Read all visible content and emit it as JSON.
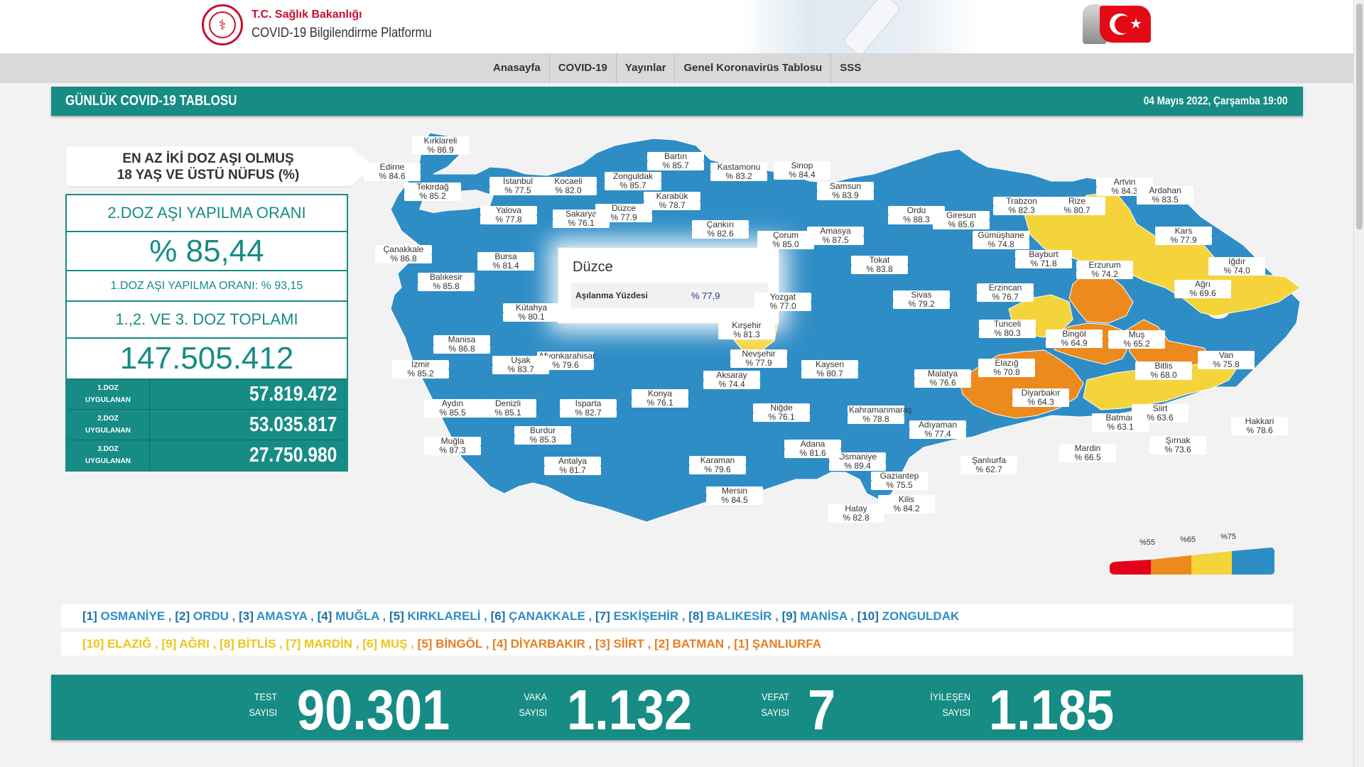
{
  "header": {
    "ministry": "T.C. Sağlık Bakanlığı",
    "platform": "COVID-19 Bilgilendirme Platformu"
  },
  "nav": [
    "Anasayfa",
    "COVID-19",
    "Yayınlar",
    "Genel Koronavirüs Tablosu",
    "SSS"
  ],
  "banner": {
    "title": "GÜNLÜK COVID-19 TABLOSU",
    "date": "04 Mayıs 2022, Çarşamba 19:00"
  },
  "vaccine": {
    "title_line1": "EN AZ İKİ DOZ AŞI OLMUŞ",
    "title_line2": "18 YAŞ VE ÜSTÜ NÜFUS (%)",
    "dose2_label": "2.DOZ AŞI YAPILMA ORANI",
    "dose2_value": "% 85,44",
    "dose1_rate": "1.DOZ AŞI YAPILMA ORANI: % 93,15",
    "total_label": "1.,2. VE 3. DOZ TOPLAMI",
    "total_value": "147.505.412",
    "doses": [
      {
        "label1": "1.DOZ",
        "label2": "UYGULANAN",
        "value": "57.819.472"
      },
      {
        "label1": "2.DOZ",
        "label2": "UYGULANAN",
        "value": "53.035.817"
      },
      {
        "label1": "3.DOZ",
        "label2": "UYGULANAN",
        "value": "27.750.980"
      }
    ]
  },
  "tooltip": {
    "title": "Düzce",
    "label": "Aşılanma Yüzdesi",
    "value": "% 77,9"
  },
  "provinces": [
    {
      "name": "Kırklareli",
      "value": "% 86.9"
    },
    {
      "name": "Edirne",
      "value": "% 84.6"
    },
    {
      "name": "Tekirdağ",
      "value": "% 85.2"
    },
    {
      "name": "İstanbul",
      "value": "% 77.5"
    },
    {
      "name": "Kocaeli",
      "value": "% 82.0"
    },
    {
      "name": "Yalova",
      "value": "% 77.8"
    },
    {
      "name": "Sakarya",
      "value": "% 76.1"
    },
    {
      "name": "Zonguldak",
      "value": "% 85.7"
    },
    {
      "name": "Bartın",
      "value": "% 85.7"
    },
    {
      "name": "Karabük",
      "value": "% 78.7"
    },
    {
      "name": "Düzce",
      "value": "% 77.9"
    },
    {
      "name": "Kastamonu",
      "value": "% 83.2"
    },
    {
      "name": "Sinop",
      "value": "% 84.4"
    },
    {
      "name": "Samsun",
      "value": "% 83.9"
    },
    {
      "name": "Çankırı",
      "value": "% 82.6"
    },
    {
      "name": "Çorum",
      "value": "% 85.0"
    },
    {
      "name": "Amasya",
      "value": "% 87.5"
    },
    {
      "name": "Ordu",
      "value": "% 88.3"
    },
    {
      "name": "Giresun",
      "value": "% 85.6"
    },
    {
      "name": "Trabzon",
      "value": "% 82.3"
    },
    {
      "name": "Rize",
      "value": "% 80.7"
    },
    {
      "name": "Artvin",
      "value": "% 84.3"
    },
    {
      "name": "Ardahan",
      "value": "% 83.5"
    },
    {
      "name": "Kars",
      "value": "% 77.9"
    },
    {
      "name": "Gümüşhane",
      "value": "% 74.8"
    },
    {
      "name": "Bayburt",
      "value": "% 71.8"
    },
    {
      "name": "Erzurum",
      "value": "% 74.2"
    },
    {
      "name": "Iğdır",
      "value": "% 74.0"
    },
    {
      "name": "Ağrı",
      "value": "% 69.6"
    },
    {
      "name": "Tokat",
      "value": "% 83.8"
    },
    {
      "name": "Sivas",
      "value": "% 79.2"
    },
    {
      "name": "Erzincan",
      "value": "% 76.7"
    },
    {
      "name": "Tunceli",
      "value": "% 80.3"
    },
    {
      "name": "Bingöl",
      "value": "% 64.9"
    },
    {
      "name": "Muş",
      "value": "% 65.2"
    },
    {
      "name": "Van",
      "value": "% 75.8"
    },
    {
      "name": "Bitlis",
      "value": "% 68.0"
    },
    {
      "name": "Elazığ",
      "value": "% 70.8"
    },
    {
      "name": "Malatya",
      "value": "% 76.6"
    },
    {
      "name": "Diyarbakır",
      "value": "% 64.3"
    },
    {
      "name": "Batman",
      "value": "% 63.1"
    },
    {
      "name": "Siirt",
      "value": "% 63.6"
    },
    {
      "name": "Hakkari",
      "value": "% 78.6"
    },
    {
      "name": "Şırnak",
      "value": "% 73.6"
    },
    {
      "name": "Mardin",
      "value": "% 66.5"
    },
    {
      "name": "Şanlıurfa",
      "value": "% 62.7"
    },
    {
      "name": "Adıyaman",
      "value": "% 77.4"
    },
    {
      "name": "Kahramanmaraş",
      "value": "% 78.8"
    },
    {
      "name": "Gaziantep",
      "value": "% 75.5"
    },
    {
      "name": "Kilis",
      "value": "% 84.2"
    },
    {
      "name": "Osmaniye",
      "value": "% 89.4"
    },
    {
      "name": "Hatay",
      "value": "% 82.8"
    },
    {
      "name": "Adana",
      "value": "% 81.6"
    },
    {
      "name": "Mersin",
      "value": "% 84.5"
    },
    {
      "name": "Karaman",
      "value": "% 79.6"
    },
    {
      "name": "Niğde",
      "value": "% 76.1"
    },
    {
      "name": "Kayseri",
      "value": "% 80.7"
    },
    {
      "name": "Nevşehir",
      "value": "% 77.9"
    },
    {
      "name": "Aksaray",
      "value": "% 74.4"
    },
    {
      "name": "Kırşehir",
      "value": "% 81.3"
    },
    {
      "name": "Yozgat",
      "value": "% 77.0"
    },
    {
      "name": "Konya",
      "value": "% 76.1"
    },
    {
      "name": "Antalya",
      "value": "% 81.7"
    },
    {
      "name": "Burdur",
      "value": "% 85.3"
    },
    {
      "name": "Isparta",
      "value": "% 82.7"
    },
    {
      "name": "Afyonkarahisar",
      "value": "% 79.6"
    },
    {
      "name": "Kütahya",
      "value": "% 80.1"
    },
    {
      "name": "Uşak",
      "value": "% 83.7"
    },
    {
      "name": "Denizli",
      "value": "% 85.1"
    },
    {
      "name": "Aydın",
      "value": "% 85.5"
    },
    {
      "name": "Muğla",
      "value": "% 87.3"
    },
    {
      "name": "İzmir",
      "value": "% 85.2"
    },
    {
      "name": "Manisa",
      "value": "% 86.8"
    },
    {
      "name": "Balıkesir",
      "value": "% 85.8"
    },
    {
      "name": "Bursa",
      "value": "% 81.4"
    },
    {
      "name": "Çanakkale",
      "value": "% 86.8"
    }
  ],
  "legend": {
    "ticks": [
      "%55",
      "%65",
      "%75"
    ],
    "colors": [
      "#e3001b",
      "#ec8a1e",
      "#f5d33b",
      "#2f8dc6"
    ]
  },
  "top_ranking": [
    {
      "rank": "[1]",
      "name": "OSMANİYE"
    },
    {
      "rank": "[2]",
      "name": "ORDU"
    },
    {
      "rank": "[3]",
      "name": "AMASYA"
    },
    {
      "rank": "[4]",
      "name": "MUĞLA"
    },
    {
      "rank": "[5]",
      "name": "KIRKLARELİ"
    },
    {
      "rank": "[6]",
      "name": "ÇANAKKALE"
    },
    {
      "rank": "[7]",
      "name": "ESKİŞEHİR"
    },
    {
      "rank": "[8]",
      "name": "BALIKESİR"
    },
    {
      "rank": "[9]",
      "name": "MANİSA"
    },
    {
      "rank": "[10]",
      "name": "ZONGULDAK"
    }
  ],
  "bottom_ranking": [
    {
      "rank": "[10]",
      "name": "ELAZIĞ",
      "tone": "yellow"
    },
    {
      "rank": "[9]",
      "name": "AĞRI",
      "tone": "yellow"
    },
    {
      "rank": "[8]",
      "name": "BİTLİS",
      "tone": "yellow"
    },
    {
      "rank": "[7]",
      "name": "MARDİN",
      "tone": "yellow"
    },
    {
      "rank": "[6]",
      "name": "MUŞ",
      "tone": "yellow"
    },
    {
      "rank": "[5]",
      "name": "BİNGÖL",
      "tone": "orange"
    },
    {
      "rank": "[4]",
      "name": "DİYARBAKIR",
      "tone": "orange"
    },
    {
      "rank": "[3]",
      "name": "SİİRT",
      "tone": "orange"
    },
    {
      "rank": "[2]",
      "name": "BATMAN",
      "tone": "orange"
    },
    {
      "rank": "[1]",
      "name": "ŞANLIURFA",
      "tone": "orange"
    }
  ],
  "stats": [
    {
      "l1": "TEST",
      "l2": "SAYISI",
      "value": "90.301"
    },
    {
      "l1": "VAKA",
      "l2": "SAYISI",
      "value": "1.132"
    },
    {
      "l1": "VEFAT",
      "l2": "SAYISI",
      "value": "7"
    },
    {
      "l1": "İYİLEŞEN",
      "l2": "SAYISI",
      "value": "1.185"
    }
  ]
}
